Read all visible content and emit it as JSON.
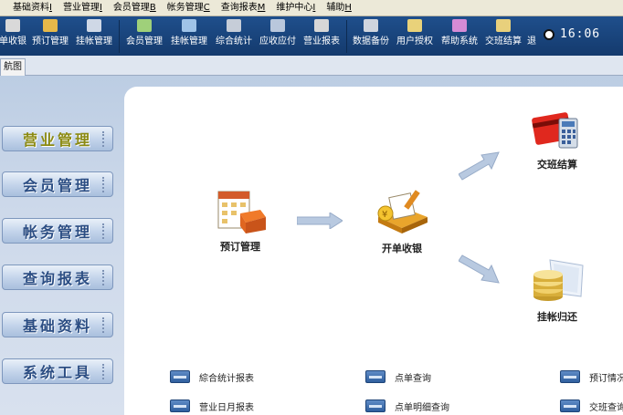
{
  "menu": [
    {
      "label": "基础资料",
      "accel": "I"
    },
    {
      "label": "营业管理",
      "accel": "I"
    },
    {
      "label": "会员管理",
      "accel": "B"
    },
    {
      "label": "帐务管理",
      "accel": "C"
    },
    {
      "label": "查询报表",
      "accel": "M"
    },
    {
      "label": "维护中心",
      "accel": "I"
    },
    {
      "label": "辅助",
      "accel": "H"
    }
  ],
  "toolbar": {
    "group1": [
      {
        "label": "单收银",
        "icon": "cash-register-icon",
        "color": "#d9d9d9"
      },
      {
        "label": "预订管理",
        "icon": "reservation-icon",
        "color": "#e6b84a"
      },
      {
        "label": "挂帐管理",
        "icon": "ledger-icon",
        "color": "#cfd8e6"
      }
    ],
    "group2": [
      {
        "label": "会员管理",
        "icon": "member-card-icon",
        "color": "#9fd07a"
      },
      {
        "label": "挂帐管理",
        "icon": "transfer-icon",
        "color": "#9fc3e8"
      },
      {
        "label": "综合统计",
        "icon": "statistics-icon",
        "color": "#c6cdd8"
      },
      {
        "label": "应收应付",
        "icon": "receivable-icon",
        "color": "#b9c7dc"
      },
      {
        "label": "营业报表",
        "icon": "report-icon",
        "color": "#d7d7d7"
      }
    ],
    "group3": [
      {
        "label": "数据备份",
        "icon": "backup-icon",
        "color": "#d0d5de"
      },
      {
        "label": "用户授权",
        "icon": "user-key-icon",
        "color": "#e9d27a"
      },
      {
        "label": "帮助系统",
        "icon": "help-icon",
        "color": "#d58bd6"
      },
      {
        "label": "交班结算",
        "icon": "shift-settle-icon",
        "color": "#e8d07c"
      },
      {
        "label": "退",
        "icon": "exit-icon",
        "color": "#1f4f8c"
      }
    ],
    "clock": "16:06"
  },
  "tab": {
    "label": "航图"
  },
  "nav": [
    {
      "label": "营业管理",
      "active": true
    },
    {
      "label": "会员管理",
      "active": false
    },
    {
      "label": "帐务管理",
      "active": false
    },
    {
      "label": "查询报表",
      "active": false
    },
    {
      "label": "基础资料",
      "active": false
    },
    {
      "label": "系统工具",
      "active": false
    }
  ],
  "diagram": {
    "reservation": "预订管理",
    "open_bill": "开单收银",
    "shift_settle": "交班结算",
    "return_credit": "挂帐归还"
  },
  "reports": [
    {
      "label": "綜合统计报表"
    },
    {
      "label": "点单查询"
    },
    {
      "label": "预订情况"
    },
    {
      "label": "营业日月报表"
    },
    {
      "label": "点单明细查询"
    },
    {
      "label": "交班查询"
    }
  ],
  "colors": {
    "toolbar_bg": "#1a467f",
    "nav_text": "#2b4d83",
    "nav_active_text": "#8b8a12",
    "arrow": "#b8c9e0"
  }
}
